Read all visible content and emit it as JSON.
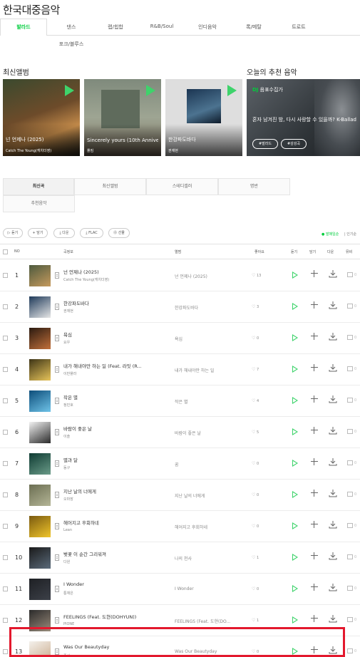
{
  "page_title": "한국대중음악",
  "genre_tabs": [
    {
      "label": "발라드",
      "active": true
    },
    {
      "label": "댄스"
    },
    {
      "label": "랩/힙합"
    },
    {
      "label": "R&B/Soul"
    },
    {
      "label": "인디음악"
    },
    {
      "label": "록/메탈"
    },
    {
      "label": "트로트"
    },
    {
      "label": "포크/블루스"
    }
  ],
  "new_albums_title": "최신앨범",
  "albums": [
    {
      "title": "넌 언제나 (2025)",
      "artist": "Catch The Young(캐치더영)"
    },
    {
      "title": "Sincerely yours (10th Anniver...",
      "artist": "폴킴"
    },
    {
      "title": "한강파도바다",
      "artist": "권재현"
    }
  ],
  "recommend": {
    "title": "오늘의 추천 음악",
    "dj_prefix": "DJ",
    "dj_name": "음표수집가",
    "text": "혼자 남겨진 밤, 다시 사랑할 수 있을까? K-Ballad",
    "chip1": "#발라드",
    "chip2": "#감성곡"
  },
  "sub_tabs": [
    "최신곡",
    "최신앨범",
    "스테디셀러",
    "명반",
    "추천음악"
  ],
  "toolbar": {
    "play": "듣기",
    "add": "담기",
    "download": "다운",
    "flac": "FLAC",
    "gift": "선물",
    "release": "● 발매일순",
    "popular": "| 인기순"
  },
  "header": {
    "no": "NO",
    "song": "곡정보",
    "album": "앨범",
    "like": "좋아요",
    "play": "듣기",
    "add": "담기",
    "download": "다운",
    "mv": "뮤비"
  },
  "songs": [
    {
      "rank": "1",
      "title": "넌 언제나 (2025)",
      "artist": "Catch The Young(캐치더영)",
      "album": "넌 언제나 (2025)",
      "likes": "13",
      "mv": "0",
      "art": [
        "#4d5a3e",
        "#c69a5d"
      ]
    },
    {
      "rank": "2",
      "title": "한강파도바다",
      "artist": "권재현",
      "album": "한강파도바다",
      "likes": "3",
      "mv": "0",
      "art": [
        "#1f3a5a",
        "#e6e6e6"
      ]
    },
    {
      "rank": "3",
      "title": "욕심",
      "artist": "요우",
      "album": "욕심",
      "likes": "0",
      "mv": "0",
      "art": [
        "#2a1a10",
        "#c2703a"
      ]
    },
    {
      "rank": "4",
      "title": "내가 해내야만 하는 일 (Feat. 라잇 (R...",
      "artist": "이반플라",
      "album": "내가 해내야만 하는 일",
      "likes": "7",
      "mv": "0",
      "art": [
        "#3d3416",
        "#e7c45a"
      ]
    },
    {
      "rank": "5",
      "title": "작은 별",
      "artist": "정민호",
      "album": "작은 별",
      "likes": "4",
      "mv": "0",
      "art": [
        "#0d4d7a",
        "#6fc3e8"
      ]
    },
    {
      "rank": "6",
      "title": "바람이 좋은 날",
      "artist": "이솔",
      "album": "바람이 좋은 날",
      "likes": "5",
      "mv": "0",
      "art": [
        "#f2f2f2",
        "#2a2a2a"
      ]
    },
    {
      "rank": "7",
      "title": "별과 달",
      "artist": "동구",
      "album": "꿈",
      "likes": "0",
      "mv": "0",
      "art": [
        "#0f3b33",
        "#6a9b88"
      ]
    },
    {
      "rank": "8",
      "title": "지난 날의 너에게",
      "artist": "오마장",
      "album": "지난 날의 너에게",
      "likes": "0",
      "mv": "0",
      "art": [
        "#6b6e52",
        "#b4b596"
      ]
    },
    {
      "rank": "9",
      "title": "헤어지고 후회하네",
      "artist": "Lean",
      "album": "헤어지고 후회하네",
      "likes": "0",
      "mv": "0",
      "art": [
        "#7a5a10",
        "#f0c52a"
      ]
    },
    {
      "rank": "10",
      "title": "벚꽃 이 순간 그리워져",
      "artist": "다원",
      "album": "나의 천사",
      "likes": "1",
      "mv": "0",
      "art": [
        "#1a1a1a",
        "#5a6a7a"
      ]
    },
    {
      "rank": "11",
      "title": "I Wonder",
      "artist": "통재은",
      "album": "I Wonder",
      "likes": "0",
      "mv": "0",
      "art": [
        "#1e2024",
        "#3c4048"
      ]
    },
    {
      "rank": "12",
      "title": "FEELINGS (Feat. 도현(DOHYUN))",
      "artist": "PIONE",
      "album": "FEELINGS (Feat. 도현(DO...",
      "likes": "1",
      "mv": "0",
      "art": [
        "#2b2b2b",
        "#9a8a7a"
      ]
    },
    {
      "rank": "13",
      "title": "Was Our Beautyday",
      "artist": "준서",
      "album": "Was Our Beautyday",
      "likes": "0",
      "mv": "0",
      "art": [
        "#f4f1ec",
        "#c9a98a"
      ]
    }
  ]
}
